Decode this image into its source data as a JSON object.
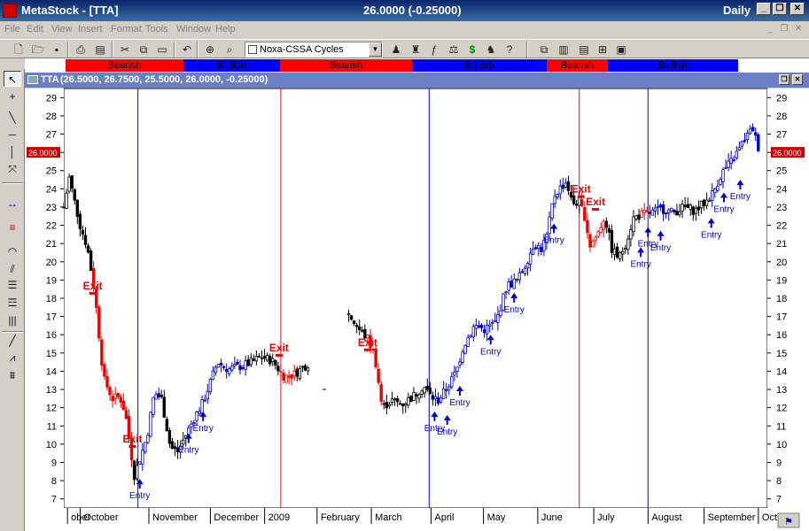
{
  "window": {
    "app_title": "MetaStock - [TTA]",
    "price_text": "26.0000 (-0.25000)",
    "period_label": "Daily",
    "minimize_glyph": "_",
    "restore_glyph": "❐",
    "close_glyph": "✕"
  },
  "menu": {
    "items": [
      "File",
      "Edit",
      "View",
      "Insert",
      "Format",
      "Tools",
      "Window",
      "Help"
    ],
    "mdi_minimize": "_",
    "mdi_restore": "❐",
    "mdi_close": "✕"
  },
  "toolbar": {
    "expert_combo_value": "Noxa-CSSA Cycles",
    "buttons": [
      "new-icon",
      "open-icon",
      "save-icon",
      "print-icon",
      "print-preview-icon",
      "cut-icon",
      "copy-icon",
      "paste-icon",
      "undo-icon",
      "crosshair-icon",
      "zoom-icon",
      "expert-advisor-icon",
      "explorer-icon",
      "function-icon",
      "system-tester-icon",
      "dollar-icon",
      "help-pointer-icon",
      "window-layout-icon",
      "tile-vertical-icon",
      "tile-horizontal-icon",
      "tile-grid-icon",
      "properties-icon"
    ]
  },
  "cycles": [
    {
      "label": "Bearish",
      "color": "#ff0000"
    },
    {
      "label": "Bullish",
      "color": "#0000ff"
    },
    {
      "label": "Bearish",
      "color": "#ff0000"
    },
    {
      "label": "Bullish",
      "color": "#0000ff"
    },
    {
      "label": "Bearish",
      "color": "#ff0000"
    },
    {
      "label": "Bullish",
      "color": "#0000ff"
    }
  ],
  "chart_window": {
    "symbol": "TTA",
    "values_text": "(26.5000, 26.7500, 25.5000, 26.0000, -0.25000)",
    "restore_glyph": "❐",
    "close_glyph": "✕"
  },
  "chart_data": {
    "type": "candlestick",
    "ylim": [
      6.5,
      29.5
    ],
    "yticks": [
      7,
      8,
      9,
      10,
      11,
      12,
      13,
      14,
      15,
      16,
      17,
      18,
      19,
      20,
      21,
      22,
      23,
      24,
      25,
      26,
      27,
      28,
      29
    ],
    "last_price_label": "26.0000",
    "last_price": 26.0,
    "x_labels": [
      "ober",
      "October",
      "November",
      "December",
      "2009",
      "February",
      "March",
      "April",
      "May",
      "June",
      "July",
      "August",
      "September",
      "Octob"
    ],
    "x_label_days": [
      -5,
      2,
      40,
      74,
      104,
      133,
      163,
      196,
      225,
      255,
      286,
      316,
      347,
      377
    ],
    "day_range": [
      -9,
      380
    ],
    "cycle_lines": [
      {
        "day": 32,
        "color": "#0000ff"
      },
      {
        "day": 111,
        "color": "#ff0000"
      },
      {
        "day": 193,
        "color": "#0000ff"
      },
      {
        "day": 276,
        "color": "#ff0000"
      },
      {
        "day": 314,
        "color": "#0000ff"
      }
    ],
    "price_path": [
      [
        -9,
        23.0
      ],
      [
        -6,
        24.6
      ],
      [
        0,
        22.0
      ],
      [
        4,
        20.8
      ],
      [
        8,
        18.4
      ],
      [
        13,
        13.6
      ],
      [
        18,
        12.5
      ],
      [
        22,
        12.6
      ],
      [
        25,
        11.7
      ],
      [
        30,
        8.3
      ],
      [
        37,
        10.4
      ],
      [
        41,
        12.8
      ],
      [
        45,
        12.5
      ],
      [
        50,
        9.8
      ],
      [
        54,
        9.6
      ],
      [
        58,
        10.4
      ],
      [
        64,
        11.6
      ],
      [
        68,
        12.3
      ],
      [
        76,
        14.5
      ],
      [
        82,
        14.1
      ],
      [
        90,
        14.3
      ],
      [
        95,
        14.5
      ],
      [
        100,
        14.8
      ],
      [
        106,
        14.6
      ],
      [
        113,
        13.7
      ],
      [
        118,
        13.8
      ],
      [
        123,
        14.2
      ],
      [
        126,
        14.4
      ],
      [
        148,
        17.2
      ],
      [
        155,
        16.2
      ],
      [
        159,
        15.8
      ],
      [
        163,
        14.8
      ],
      [
        167,
        12.0
      ],
      [
        172,
        12.4
      ],
      [
        178,
        12.2
      ],
      [
        184,
        12.6
      ],
      [
        190,
        13.2
      ],
      [
        194,
        12.6
      ],
      [
        198,
        12.4
      ],
      [
        203,
        13.1
      ],
      [
        208,
        14.0
      ],
      [
        212,
        15.4
      ],
      [
        218,
        16.5
      ],
      [
        224,
        16.3
      ],
      [
        230,
        16.7
      ],
      [
        236,
        18.7
      ],
      [
        242,
        19.0
      ],
      [
        246,
        19.8
      ],
      [
        251,
        21.0
      ],
      [
        255,
        20.7
      ],
      [
        258,
        21.4
      ],
      [
        262,
        23.6
      ],
      [
        265,
        24.0
      ],
      [
        269,
        24.4
      ],
      [
        272,
        23.2
      ],
      [
        276,
        23.3
      ],
      [
        279,
        22.5
      ],
      [
        282,
        20.9
      ],
      [
        286,
        21.5
      ],
      [
        290,
        22.5
      ],
      [
        294,
        20.7
      ],
      [
        298,
        20.2
      ],
      [
        302,
        21.1
      ],
      [
        306,
        22.4
      ],
      [
        311,
        22.6
      ],
      [
        316,
        22.7
      ],
      [
        322,
        22.9
      ],
      [
        328,
        22.7
      ],
      [
        334,
        23.0
      ],
      [
        340,
        22.8
      ],
      [
        346,
        23.3
      ],
      [
        350,
        23.8
      ],
      [
        355,
        24.9
      ],
      [
        360,
        25.5
      ],
      [
        364,
        26.1
      ],
      [
        368,
        26.8
      ],
      [
        372,
        27.3
      ],
      [
        374,
        26.6
      ],
      [
        376,
        26.0
      ]
    ],
    "stray_point": {
      "day": 135,
      "price": 13.0
    },
    "signals": [
      {
        "label": "Exit",
        "type": "exit",
        "day": 7,
        "price": 18.2
      },
      {
        "label": "Exit",
        "type": "exit",
        "day": 29,
        "price": 9.8
      },
      {
        "label": "Entry",
        "type": "entry",
        "day": 33,
        "price": 8.0
      },
      {
        "label": "Entry",
        "type": "entry",
        "day": 60,
        "price": 10.5
      },
      {
        "label": "Entry",
        "type": "entry",
        "day": 68,
        "price": 11.7
      },
      {
        "label": "Exit",
        "type": "exit",
        "day": 110,
        "price": 14.8
      },
      {
        "label": "Exit",
        "type": "exit",
        "day": 159,
        "price": 15.1
      },
      {
        "label": "Entry",
        "type": "entry",
        "day": 196,
        "price": 11.7
      },
      {
        "label": "Entry",
        "type": "entry",
        "day": 203,
        "price": 11.5
      },
      {
        "label": "Entry",
        "type": "entry",
        "day": 210,
        "price": 13.1
      },
      {
        "label": "Entry",
        "type": "entry",
        "day": 227,
        "price": 15.9
      },
      {
        "label": "Entry",
        "type": "entry",
        "day": 240,
        "price": 18.2
      },
      {
        "label": "Entry",
        "type": "entry",
        "day": 262,
        "price": 22.0
      },
      {
        "label": "Exit",
        "type": "exit",
        "day": 277,
        "price": 23.5
      },
      {
        "label": "Exit",
        "type": "exit",
        "day": 285,
        "price": 22.8
      },
      {
        "label": "Entry",
        "type": "entry",
        "day": 310,
        "price": 20.7
      },
      {
        "label": "Entry",
        "type": "entry",
        "day": 314,
        "price": 21.8
      },
      {
        "label": "Entry",
        "type": "entry",
        "day": 321,
        "price": 21.6
      },
      {
        "label": "Entry",
        "type": "entry",
        "day": 349,
        "price": 22.3
      },
      {
        "label": "Entry",
        "type": "entry",
        "day": 356,
        "price": 23.7
      },
      {
        "label": "Entry",
        "type": "entry",
        "day": 365,
        "price": 24.4
      }
    ],
    "colors": {
      "bullish": "#0000cc",
      "bearish": "#ee0000",
      "neutral": "#000000",
      "entry": "#0000cc",
      "exit": "#ee0000",
      "last_price_bg": "#cc0000"
    }
  },
  "colors": {
    "title_gradient_start": "#0a246a",
    "title_gradient_end": "#3a6ea5",
    "chart_title_bg": "#6b7fc4",
    "chrome": "#d4d0c8"
  }
}
